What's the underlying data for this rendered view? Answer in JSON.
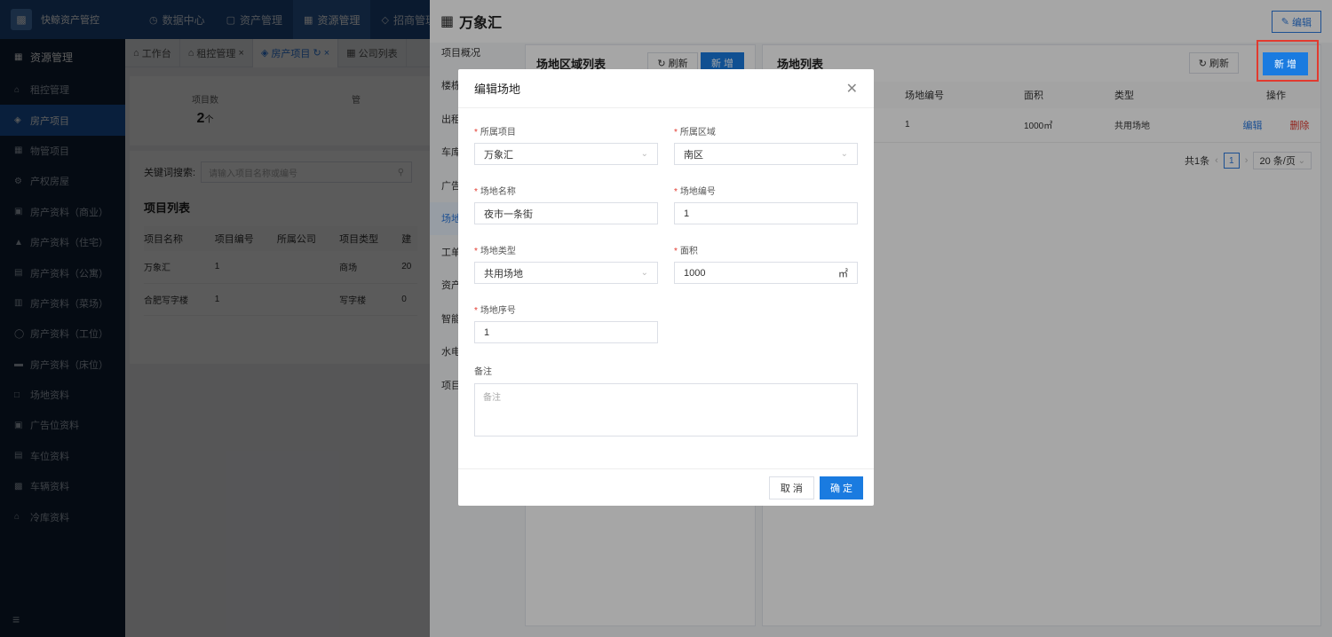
{
  "app": {
    "logo_text": "快鲸资产管控"
  },
  "topnav": [
    {
      "label": "数据中心",
      "icon": "clock-icon"
    },
    {
      "label": "资产管理",
      "icon": "box-icon"
    },
    {
      "label": "资源管理",
      "icon": "building-icon",
      "active": true
    },
    {
      "label": "招商管理",
      "icon": "tag-icon"
    }
  ],
  "sidebar": {
    "header": "资源管理",
    "items": [
      "租控管理",
      "房产项目",
      "物管项目",
      "产权房屋",
      "房产资料（商业）",
      "房产资料（住宅）",
      "房产资料（公寓）",
      "房产资料（菜场）",
      "房产资料（工位）",
      "房产资料（床位）",
      "场地资料",
      "广告位资料",
      "车位资料",
      "车辆资料",
      "冷库资料"
    ],
    "active_index": 1
  },
  "tabs": [
    {
      "label": "工作台"
    },
    {
      "label": "租控管理"
    },
    {
      "label": "房产项目",
      "active": true
    },
    {
      "label": "公司列表"
    }
  ],
  "stats": [
    {
      "label": "项目数",
      "value": "2",
      "unit": "个"
    },
    {
      "label": "管",
      "value": "",
      "unit": ""
    }
  ],
  "project_list": {
    "search_label": "关键词搜索:",
    "search_placeholder": "请输入项目名称或编号",
    "title": "项目列表",
    "columns": [
      "项目名称",
      "项目编号",
      "所属公司",
      "项目类型",
      "建"
    ],
    "rows": [
      [
        "万象汇",
        "1",
        "",
        "商场",
        "20"
      ],
      [
        "合肥写字楼",
        "1",
        "",
        "写字楼",
        "0"
      ]
    ]
  },
  "drawer": {
    "title": "万象汇",
    "edit_label": "编辑",
    "side_items": [
      "项目概况",
      "楼栋",
      "出租",
      "车库",
      "广告",
      "场地",
      "工单",
      "资产",
      "智能",
      "水电",
      "项目"
    ],
    "side_active_index": 5,
    "zone_panel": {
      "title": "场地区域列表",
      "refresh_label": "刷新",
      "add_label": "新 增"
    },
    "site_panel": {
      "title": "场地列表",
      "refresh_label": "刷新",
      "add_label": "新 增",
      "columns": [
        "",
        "场地编号",
        "面积",
        "类型",
        "操作"
      ],
      "rows": [
        {
          "name": "",
          "code": "1",
          "area": "1000㎡",
          "type": "共用场地",
          "edit": "编辑",
          "delete": "删除"
        }
      ],
      "pager": {
        "total": "共1条",
        "page": "1",
        "page_size": "20 条/页"
      }
    }
  },
  "modal": {
    "title": "编辑场地",
    "fields": {
      "project": {
        "label": "所属项目",
        "value": "万象汇"
      },
      "zone": {
        "label": "所属区域",
        "value": "南区"
      },
      "site_name": {
        "label": "场地名称",
        "value": "夜市一条街"
      },
      "site_code": {
        "label": "场地编号",
        "value": "1"
      },
      "site_type": {
        "label": "场地类型",
        "value": "共用场地"
      },
      "area": {
        "label": "面积",
        "value": "1000",
        "unit": "㎡"
      },
      "order": {
        "label": "场地序号",
        "value": "1"
      },
      "remark": {
        "label": "备注",
        "placeholder": "备注"
      }
    },
    "cancel_label": "取 消",
    "ok_label": "确 定"
  },
  "colors": {
    "primary": "#1a7be0",
    "nav": "#1e4c86",
    "sidebar": "#0f2038",
    "highlight": "#e23a2f"
  }
}
